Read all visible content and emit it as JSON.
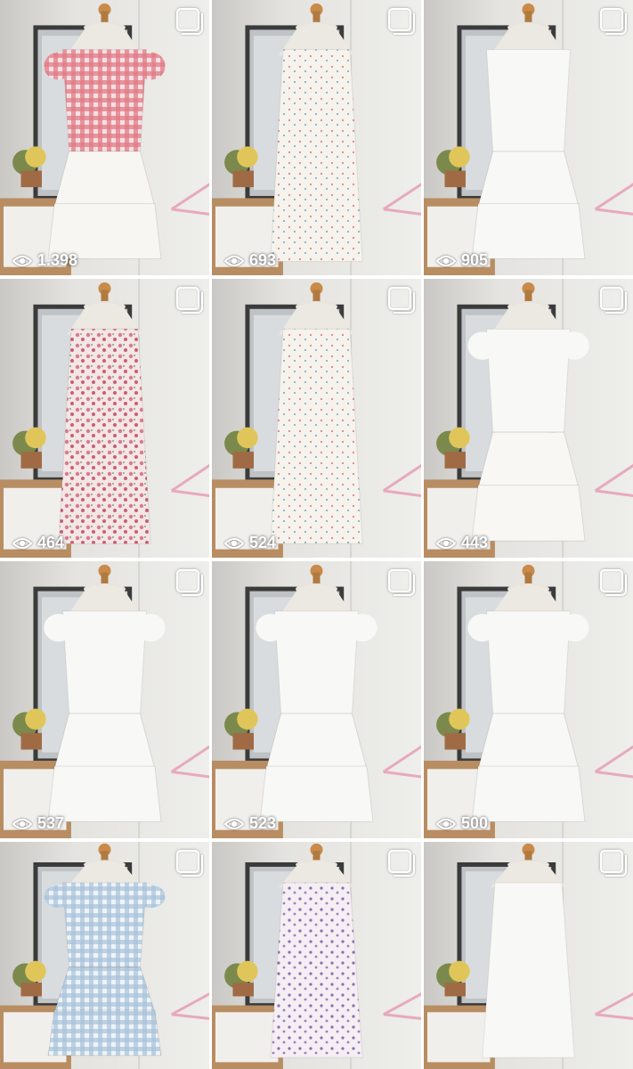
{
  "grid": {
    "items": [
      {
        "views": "1.398",
        "outfit": "red-gingham-top-white-tiered-skirt",
        "top_color": "#d9646e",
        "bottom_color": "#f7f6f2",
        "pattern": "gingham"
      },
      {
        "views": "693",
        "outfit": "white-floral-slip-dress",
        "top_color": "#f4efe8",
        "bottom_color": "#f4efe8",
        "pattern": "floral-small"
      },
      {
        "views": "905",
        "outfit": "white-cardigan-tiered-skirt",
        "top_color": "#f6f6f4",
        "bottom_color": "#f8f8f6",
        "pattern": "plain"
      },
      {
        "views": "464",
        "outfit": "pink-floral-smocked-dress",
        "top_color": "#e9d6d8",
        "bottom_color": "#e9d6d8",
        "pattern": "floral-pink"
      },
      {
        "views": "524",
        "outfit": "white-embroidered-dress",
        "top_color": "#f4f3ef",
        "bottom_color": "#f4f3ef",
        "pattern": "floral-small"
      },
      {
        "views": "443",
        "outfit": "white-knit-top-tiered-skirt",
        "top_color": "#f3f2ee",
        "bottom_color": "#f8f7f4",
        "pattern": "plain"
      },
      {
        "views": "537",
        "outfit": "white-flutter-top-tiered-skirt",
        "top_color": "#f7f7f5",
        "bottom_color": "#f8f8f6",
        "pattern": "plain"
      },
      {
        "views": "523",
        "outfit": "white-puff-top-tiered-skirt",
        "top_color": "#f7f7f5",
        "bottom_color": "#f8f8f6",
        "pattern": "plain"
      },
      {
        "views": "500",
        "outfit": "white-puff-blouse-tiered-skirt",
        "top_color": "#f8f8f6",
        "bottom_color": "#f8f8f6",
        "pattern": "plain"
      },
      {
        "views": "",
        "outfit": "blue-gingham-set",
        "top_color": "#cfdbe6",
        "bottom_color": "#d6dfe6",
        "pattern": "gingham-blue"
      },
      {
        "views": "",
        "outfit": "lilac-floral-slip-dress",
        "top_color": "#ece4ea",
        "bottom_color": "#ece4ea",
        "pattern": "floral-purple"
      },
      {
        "views": "",
        "outfit": "white-ruched-mini-dress",
        "top_color": "#f7f7f5",
        "bottom_color": "#f7f7f5",
        "pattern": "plain"
      }
    ]
  },
  "icons": {
    "views": "eye-icon",
    "select": "multi-select-icon"
  },
  "colors": {
    "wall": "#e7e6e2",
    "mannequin": "#c98a4a",
    "hanger": "#e7a9bd",
    "overlay_text": "#ffffff"
  }
}
